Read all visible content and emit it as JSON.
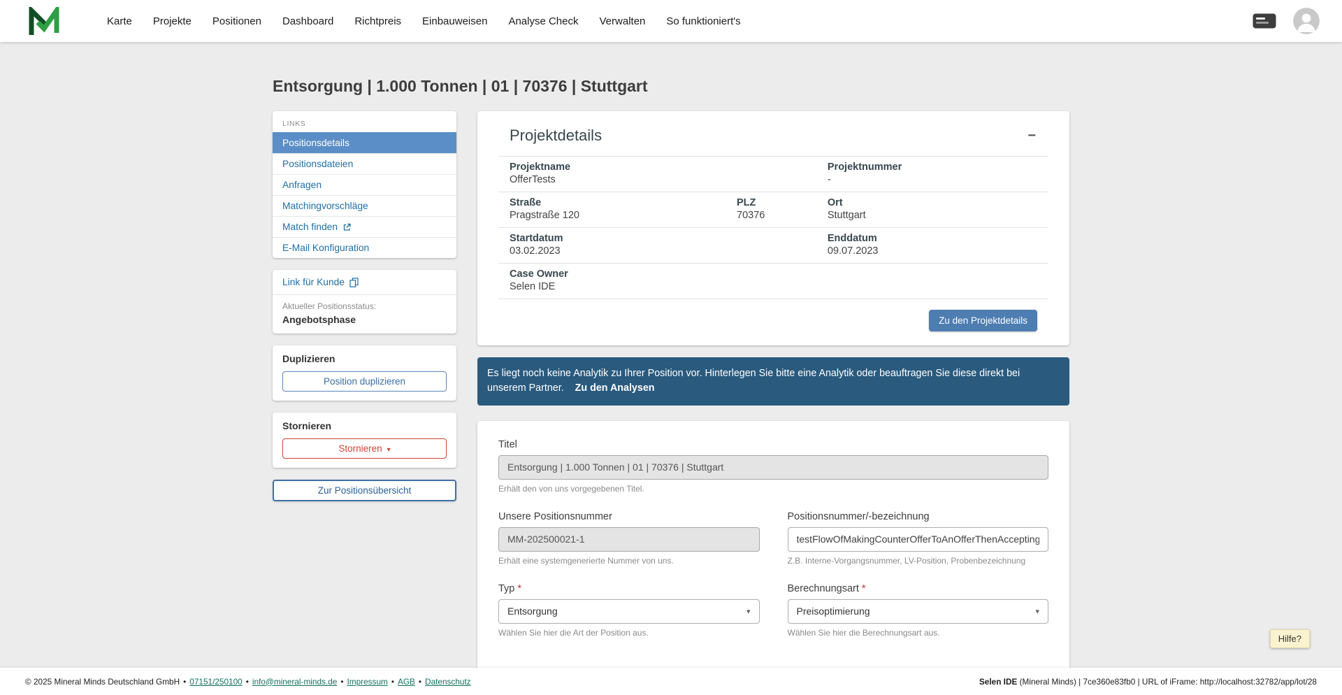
{
  "nav": {
    "items": [
      "Karte",
      "Projekte",
      "Positionen",
      "Dashboard",
      "Richtpreis",
      "Einbauweisen",
      "Analyse Check",
      "Verwalten",
      "So funktioniert's"
    ]
  },
  "page": {
    "title": "Entsorgung | 1.000 Tonnen | 01 | 70376 | Stuttgart"
  },
  "icons": {
    "collapse": "−",
    "caret": "▾",
    "separator": "•"
  },
  "colors": {
    "accent_blue": "#5b8ec6",
    "primary_button": "#4d7db1",
    "banner_blue": "#2a5a7e",
    "danger_red": "#cf4436",
    "brand_green": "#2f9e44"
  },
  "sidebar": {
    "links_header": "LINKS",
    "items": [
      {
        "label": "Positionsdetails",
        "active": true
      },
      {
        "label": "Positionsdateien"
      },
      {
        "label": "Anfragen"
      },
      {
        "label": "Matchingvorschläge"
      },
      {
        "label": "Match finden",
        "external": true
      },
      {
        "label": "E-Mail Konfiguration"
      }
    ],
    "customer_link": "Link für Kunde",
    "status_label": "Aktueller Positionsstatus:",
    "status_value": "Angebotsphase",
    "duplicate_header": "Duplizieren",
    "duplicate_button": "Position duplizieren",
    "cancel_header": "Stornieren",
    "cancel_button": "Stornieren",
    "overview_button": "Zur Positionsübersicht"
  },
  "project": {
    "title": "Projektdetails",
    "fields": [
      {
        "label": "Projektname",
        "value": "OfferTests"
      },
      {
        "label": "Projektnummer",
        "value": "-"
      },
      {
        "label": "Straße",
        "value": "Pragstraße 120"
      },
      {
        "label": "PLZ",
        "value": "70376"
      },
      {
        "label": "Ort",
        "value": "Stuttgart"
      },
      {
        "label": "Startdatum",
        "value": "03.02.2023"
      },
      {
        "label": "Enddatum",
        "value": "09.07.2023"
      },
      {
        "label": "Case Owner",
        "value": "Selen IDE"
      }
    ],
    "details_button": "Zu den Projektdetails"
  },
  "banner": {
    "text": "Es liegt noch keine Analytik zu Ihrer Position vor. Hinterlegen Sie bitte eine Analytik oder beauftragen Sie diese direkt bei unserem Partner.",
    "link": "Zu den Analysen"
  },
  "form": {
    "required_mark": "*",
    "titel_label": "Titel",
    "titel_value": "Entsorgung | 1.000 Tonnen | 01 | 70376 | Stuttgart",
    "titel_help": "Erhält den von uns vorgegebenen Titel.",
    "posnr_label": "Unsere Positionsnummer",
    "posnr_value": "MM-202500021-1",
    "posnr_help": "Erhält eine systemgenerierte Nummer von uns.",
    "bezeichnung_label": "Positionsnummer/-bezeichnung",
    "bezeichnung_value": "testFlowOfMakingCounterOfferToAnOfferThenAccepting",
    "bezeichnung_help": "Z.B. Interne-Vorgangsnummer, LV-Position, Probenbezeichnung",
    "typ_label": "Typ",
    "typ_value": "Entsorgung",
    "typ_help": "Wählen Sie hier die Art der Position aus.",
    "berechnungsart_label": "Berechnungsart",
    "berechnungsart_value": "Preisoptimierung",
    "berechnungsart_help": "Wählen Sie hier die Berechnungsart aus."
  },
  "help_button": "Hilfe?",
  "footer": {
    "copyright": "© 2025 Mineral Minds Deutschland GmbH",
    "phone": "07151/250100",
    "email": "info@mineral-minds.de",
    "impressum": "Impressum",
    "agb": "AGB",
    "datenschutz": "Datenschutz",
    "right_prefix": "Selen IDE",
    "right_suffix": "(Mineral Minds) | 7ce360e83fb0 | URL of iFrame: http://localhost:32782/app/lot/28"
  }
}
